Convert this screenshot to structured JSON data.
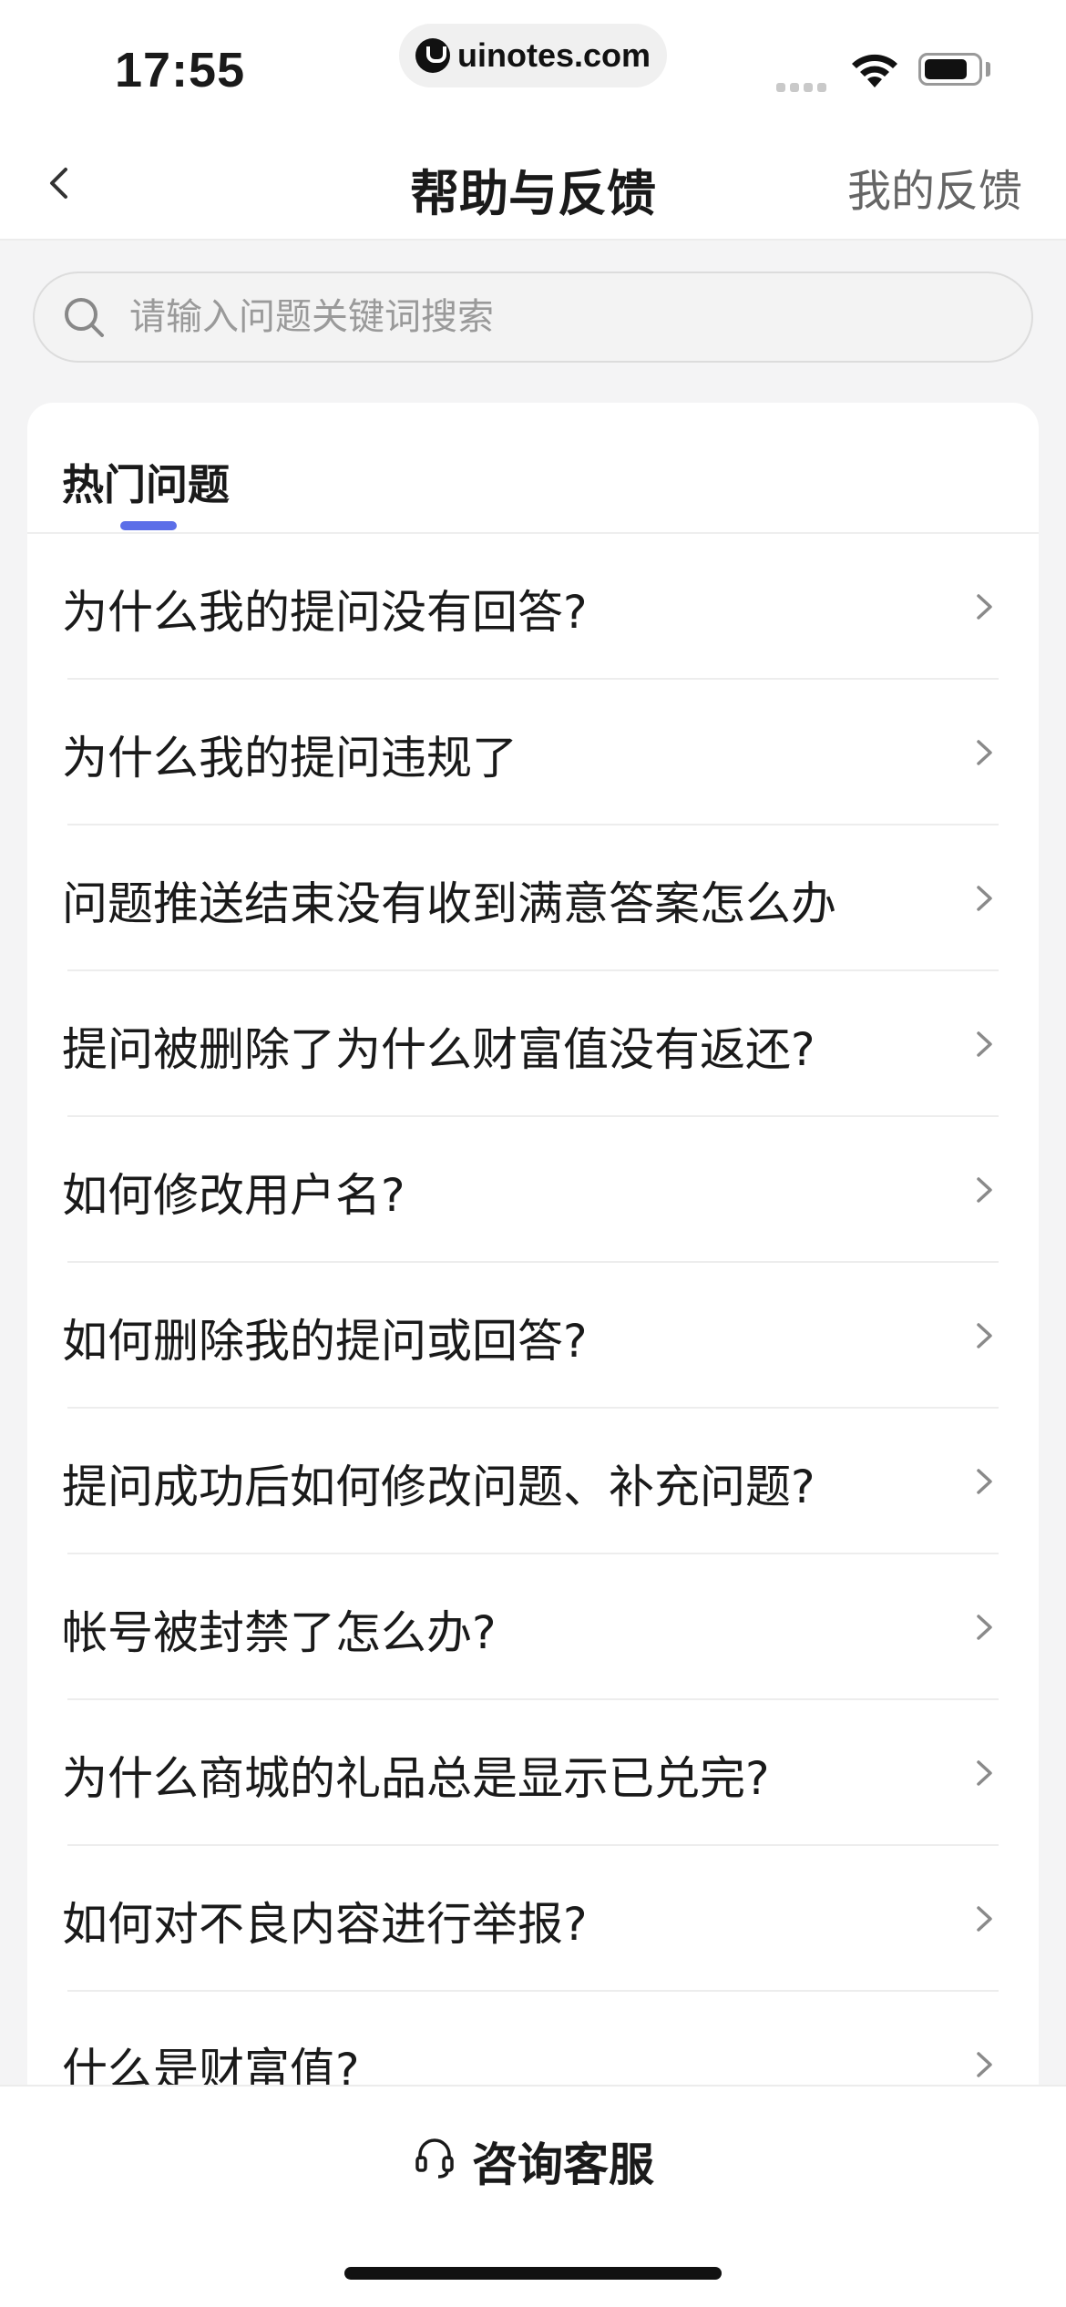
{
  "status_bar": {
    "time": "17:55",
    "url": "uinotes.com",
    "icons": [
      "lock-icon",
      "cellular-signal-icon",
      "wifi-icon",
      "battery-icon"
    ]
  },
  "nav": {
    "back_icon": "chevron-left-icon",
    "title": "帮助与反馈",
    "right_label": "我的反馈"
  },
  "search": {
    "icon": "search-icon",
    "placeholder": "请输入问题关键词搜索",
    "value": ""
  },
  "tabs": [
    {
      "label": "热门问题",
      "active": true
    }
  ],
  "faq": {
    "items": [
      "为什么我的提问没有回答?",
      "为什么我的提问违规了",
      "问题推送结束没有收到满意答案怎么办",
      "提问被删除了为什么财富值没有返还?",
      "如何修改用户名?",
      "如何删除我的提问或回答?",
      "提问成功后如何修改问题、补充问题?",
      "帐号被封禁了怎么办?",
      "为什么商城的礼品总是显示已兑完?",
      "如何对不良内容进行举报?",
      "什么是财富值?"
    ],
    "chevron_icon": "chevron-right-icon"
  },
  "bottom_bar": {
    "service_icon": "headset-icon",
    "service_label": "咨询客服"
  },
  "colors": {
    "accent": "#5b6ee8",
    "background": "#f4f4f5",
    "card": "#ffffff",
    "text_primary": "#1a1a1a",
    "text_secondary": "#666666",
    "placeholder": "#9a9a9a"
  }
}
